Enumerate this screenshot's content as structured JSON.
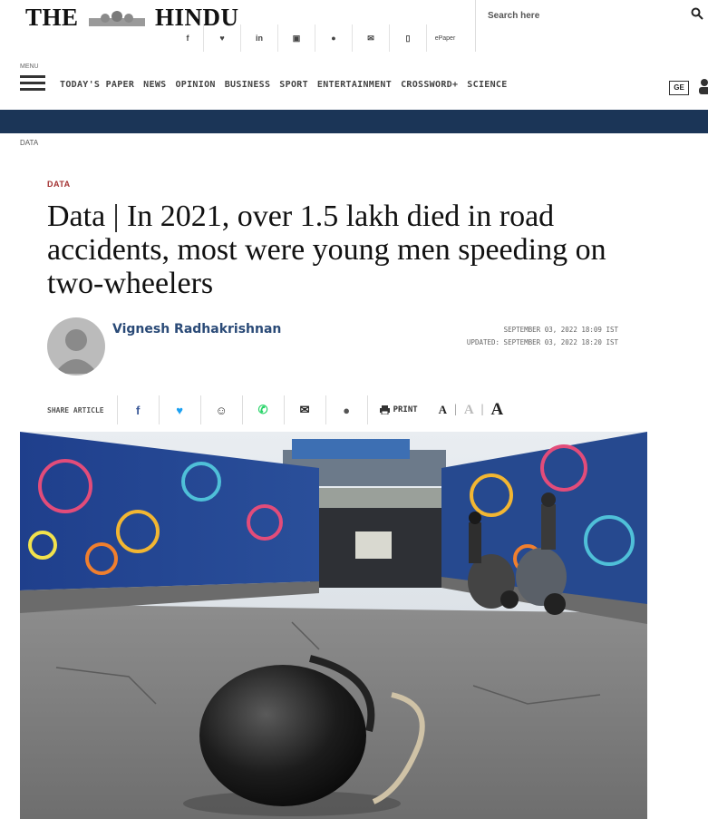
{
  "header": {
    "logo_left": "THE",
    "logo_right": "HINDU",
    "social": [
      "f",
      "♥",
      "in",
      "▣",
      "●",
      "✉",
      "▯",
      "ePaper"
    ],
    "search_placeholder": "Search here"
  },
  "nav": {
    "menu_label": "MENU",
    "items": [
      "TODAY'S PAPER",
      "NEWS",
      "OPINION",
      "BUSINESS",
      "SPORT",
      "ENTERTAINMENT",
      "CROSSWORD+",
      "SCIENCE"
    ],
    "paper_icon_label": "GE"
  },
  "breadcrumb": "DATA",
  "article": {
    "section": "DATA",
    "headline": "Data | In 2021, over 1.5 lakh died in road accidents, most were young men speeding on two-wheelers",
    "author": "Vignesh Radhakrishnan",
    "published": "SEPTEMBER 03, 2022 18:09 IST",
    "updated": "UPDATED: SEPTEMBER 03, 2022 18:20 IST",
    "share_label": "SHARE ARTICLE",
    "share_buttons": [
      {
        "icon": "f",
        "color": "#3b5998",
        "name": "facebook-icon"
      },
      {
        "icon": "♥",
        "color": "#1da1f2",
        "name": "twitter-icon"
      },
      {
        "icon": "☺",
        "color": "#333333",
        "name": "reddit-icon"
      },
      {
        "icon": "✆",
        "color": "#25d366",
        "name": "whatsapp-icon"
      },
      {
        "icon": "✉",
        "color": "#222222",
        "name": "email-icon"
      },
      {
        "icon": "●",
        "color": "#555555",
        "name": "comment-icon"
      }
    ],
    "print_label": "PRINT",
    "font_sizes": [
      "A",
      "A",
      "A"
    ]
  },
  "colors": {
    "nav_band": "#1b3557",
    "section_red": "#a33232",
    "author_blue": "#2a4a77"
  }
}
